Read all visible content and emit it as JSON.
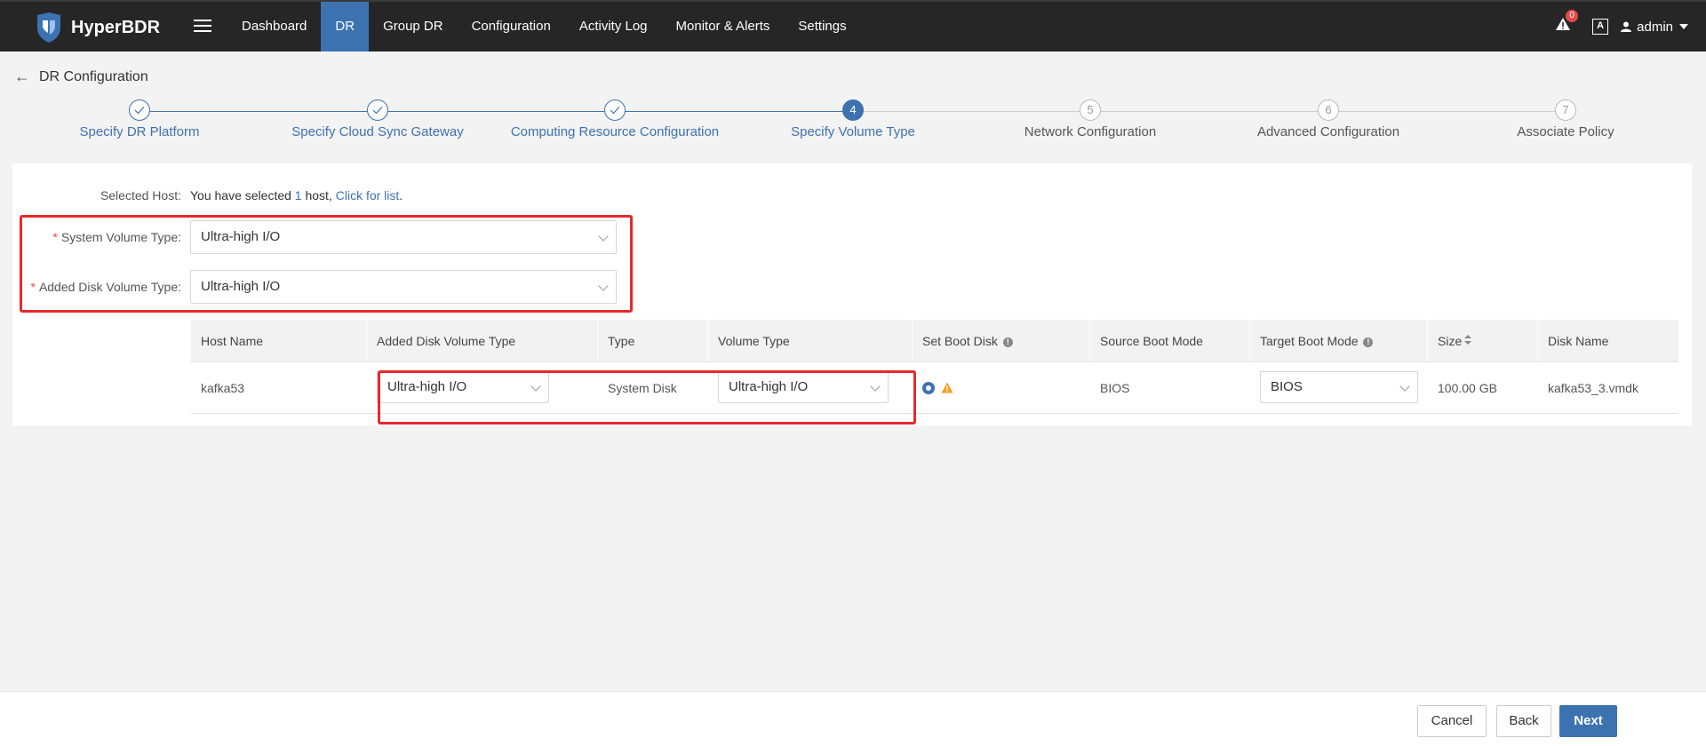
{
  "app": {
    "name": "HyperBDR"
  },
  "nav": {
    "items": [
      "Dashboard",
      "DR",
      "Group DR",
      "Configuration",
      "Activity Log",
      "Monitor & Alerts",
      "Settings"
    ],
    "active": "DR"
  },
  "header_right": {
    "alert_count": "0",
    "font_icon": "A",
    "user": "admin"
  },
  "page": {
    "title": "DR Configuration"
  },
  "steps": [
    {
      "num": "1",
      "label": "Specify DR Platform",
      "state": "done"
    },
    {
      "num": "2",
      "label": "Specify Cloud Sync Gateway",
      "state": "done"
    },
    {
      "num": "3",
      "label": "Computing Resource Configuration",
      "state": "done"
    },
    {
      "num": "4",
      "label": "Specify Volume Type",
      "state": "current"
    },
    {
      "num": "5",
      "label": "Network Configuration",
      "state": "pending"
    },
    {
      "num": "6",
      "label": "Advanced Configuration",
      "state": "pending"
    },
    {
      "num": "7",
      "label": "Associate Policy",
      "state": "pending"
    }
  ],
  "form": {
    "selected_host_label": "Selected Host:",
    "selected_prefix": "You have selected ",
    "selected_count": "1",
    "selected_mid": " host, ",
    "selected_link": "Click for list",
    "selected_suffix": ".",
    "system_volume_label": "System Volume Type:",
    "system_volume_value": "Ultra-high I/O",
    "added_disk_label": "Added Disk Volume Type:",
    "added_disk_value": "Ultra-high I/O"
  },
  "table": {
    "headers": [
      "Host Name",
      "Added Disk Volume Type",
      "Type",
      "Volume Type",
      "Set Boot Disk",
      "Source Boot Mode",
      "Target Boot Mode",
      "Size",
      "Disk Name"
    ],
    "rows": [
      {
        "host_name": "kafka53",
        "added_disk_volume_type": "Ultra-high I/O",
        "type": "System Disk",
        "volume_type": "Ultra-high I/O",
        "source_boot_mode": "BIOS",
        "target_boot_mode": "BIOS",
        "size": "100.00 GB",
        "disk_name": "kafka53_3.vmdk"
      }
    ]
  },
  "footer": {
    "cancel": "Cancel",
    "back": "Back",
    "next": "Next"
  },
  "colors": {
    "accent": "#3d72b0",
    "highlight_box": "#e8282b",
    "topbar": "#262626",
    "warning": "#f0a020"
  }
}
